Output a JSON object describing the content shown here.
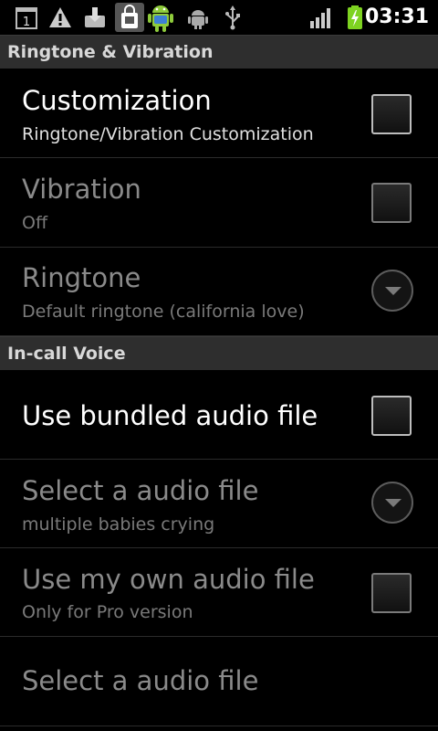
{
  "status_bar": {
    "time": "03:31",
    "notification_count": "1",
    "icons": [
      "notification-1-icon",
      "warning-icon",
      "download-icon",
      "shopping-bag-icon",
      "android-icon",
      "android-debug-icon",
      "usb-icon",
      "signal-icon",
      "battery-charging-icon"
    ]
  },
  "sections": {
    "ringtone_vibration": {
      "header": "Ringtone & Vibration"
    },
    "in_call_voice": {
      "header": "In-call Voice"
    }
  },
  "prefs": {
    "customization": {
      "title": "Customization",
      "summary": "Ringtone/Vibration Customization",
      "checked": false
    },
    "vibration": {
      "title": "Vibration",
      "summary": "Off",
      "checked": false
    },
    "ringtone": {
      "title": "Ringtone",
      "summary": "Default ringtone (california love)"
    },
    "use_bundled": {
      "title": "Use bundled audio file",
      "checked": false
    },
    "select_audio_1": {
      "title": "Select a audio file",
      "summary": "multiple babies crying"
    },
    "use_own": {
      "title": "Use my own audio file",
      "summary": "Only for Pro version",
      "checked": false
    },
    "select_audio_2": {
      "title": "Select a audio file"
    }
  },
  "colors": {
    "section_bg": "#2e2e2e",
    "battery": "#7ed321",
    "enabled_text": "#ffffff",
    "disabled_text": "#8a8a8a"
  }
}
